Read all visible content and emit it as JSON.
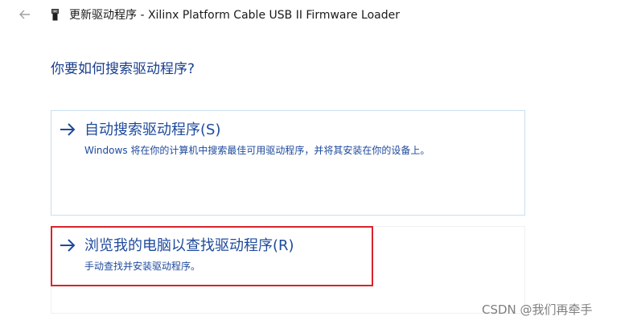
{
  "titlebar": {
    "back_icon": "arrow-left-icon",
    "device_icon": "usb-device-icon",
    "title": "更新驱动程序 - Xilinx Platform Cable USB II Firmware Loader"
  },
  "question": "你要如何搜索驱动程序?",
  "options": [
    {
      "icon": "arrow-right-icon",
      "title": "自动搜索驱动程序(S)",
      "description": "Windows 将在你的计算机中搜索最佳可用驱动程序，并将其安装在你的设备上。"
    },
    {
      "icon": "arrow-right-icon",
      "title": "浏览我的电脑以查找驱动程序(R)",
      "description": "手动查找并安装驱动程序。"
    }
  ],
  "colors": {
    "accent": "#1e4a9c",
    "highlight": "#d9242b",
    "option_border": "#c8dff0"
  },
  "watermark": "CSDN @我们再牵手"
}
